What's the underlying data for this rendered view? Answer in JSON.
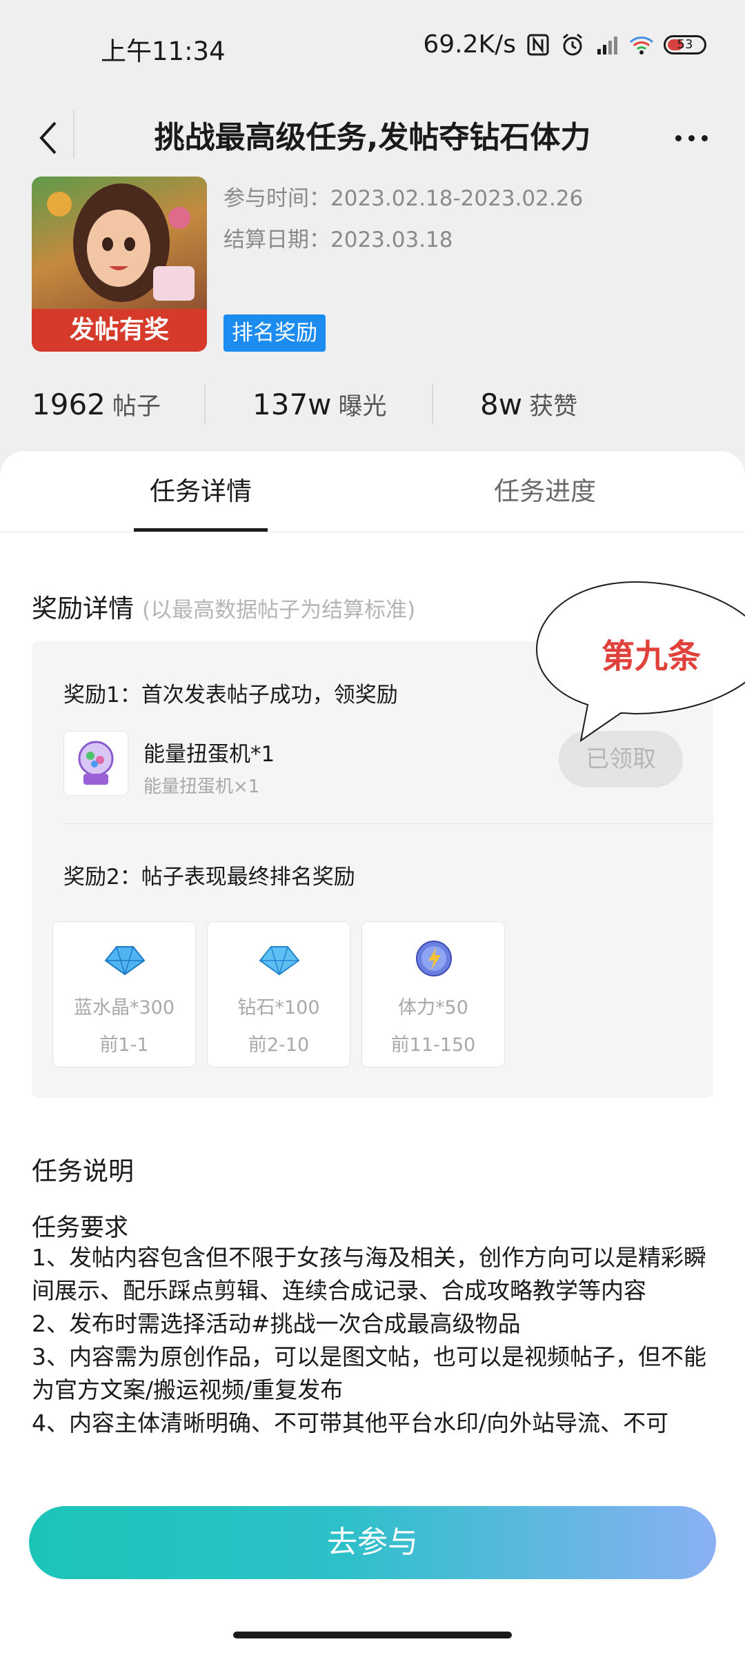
{
  "status_bar": {
    "time": "上午11:34",
    "speed": "69.2K/s",
    "battery": "53"
  },
  "nav": {
    "title": "挑战最高级任务,发帖夺钻石体力"
  },
  "task": {
    "cover_label": "发帖有奖",
    "participation_time": "参与时间：2023.02.18-2023.02.26",
    "settlement_date": "结算日期：2023.03.18",
    "tag": "排名奖励"
  },
  "stats": [
    {
      "value": "1962",
      "unit": "帖子"
    },
    {
      "value": "137w",
      "unit": "曝光"
    },
    {
      "value": "8w",
      "unit": "获赞"
    }
  ],
  "tabs": [
    {
      "label": "任务详情",
      "active": true
    },
    {
      "label": "任务进度",
      "active": false
    }
  ],
  "reward": {
    "title": "奖励详情",
    "hint": "(以最高数据帖子为结算标准)",
    "reward1": {
      "title": "奖励1：首次发表帖子成功，领奖励",
      "item_name": "能量扭蛋机*1",
      "item_sub": "能量扭蛋机×1",
      "button": "已领取"
    },
    "reward2": {
      "title": "奖励2：帖子表现最终排名奖励",
      "prizes": [
        {
          "name": "蓝水晶*300",
          "rank": "前1-1",
          "icon": "blue-crystal-icon"
        },
        {
          "name": "钻石*100",
          "rank": "前2-10",
          "icon": "diamond-icon"
        },
        {
          "name": "体力*50",
          "rank": "前11-150",
          "icon": "energy-icon"
        }
      ]
    }
  },
  "annotation": {
    "text": "第九条"
  },
  "description": {
    "title": "任务说明",
    "requirement_title": "任务要求",
    "items": [
      "1、发帖内容包含但不限于女孩与海及相关，创作方向可以是精彩瞬间展示、配乐踩点剪辑、连续合成记录、合成攻略教学等内容",
      "2、发布时需选择活动#挑战一次合成最高级物品",
      "3、内容需为原创作品，可以是图文帖，也可以是视频帖子，但不能为官方文案/搬运视频/重复发布",
      "4、内容主体清晰明确、不可带其他平台水印/向外站导流、不可"
    ]
  },
  "footer": {
    "join_button": "去参与"
  },
  "colors": {
    "accent_blue": "#1c8cf0",
    "annotation_red": "#e0413a",
    "button_start": "#1cc4b8",
    "button_end": "#8ab0f4"
  }
}
